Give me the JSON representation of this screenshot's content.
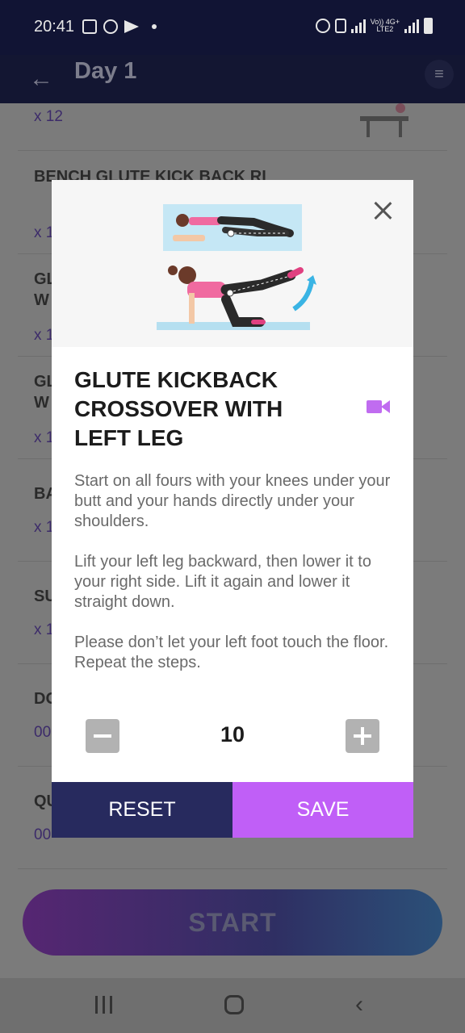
{
  "status_bar": {
    "time": "20:41",
    "network_label_top": "Vo)) 4G+",
    "network_label_bottom": "LTE2"
  },
  "app_bar": {
    "title": "Day 1"
  },
  "background_list": [
    {
      "name": "",
      "count": "x 12"
    },
    {
      "name": "BENCH GLUTE KICK BACK RI",
      "count": "x 1"
    },
    {
      "name": "GL W",
      "count": "x 1"
    },
    {
      "name": "GL W",
      "count": "x 1"
    },
    {
      "name": "BA",
      "count": "x 1"
    },
    {
      "name": "SU",
      "count": "x 1"
    },
    {
      "name": "DO",
      "count": "00"
    },
    {
      "name": "QU",
      "count": "00"
    }
  ],
  "start_button": {
    "label": "START"
  },
  "dialog": {
    "title": "GLUTE KICKBACK CROSSOVER WITH LEFT LEG",
    "description": [
      "Start on all fours with your knees under your butt and your hands directly under your shoulders.",
      "Lift your left leg backward, then lower it to your right side. Lift it again and lower it straight down.",
      "Please don’t let your left foot touch the floor. Repeat the steps."
    ],
    "reps_value": "10",
    "reset_label": "RESET",
    "save_label": "SAVE"
  },
  "colors": {
    "accent_purple": "#c05ff7",
    "navy": "#272a5e",
    "icon_purple": "#c06cf0"
  },
  "icons": {
    "back": "arrow-left-icon",
    "edit_list": "edit-list-icon",
    "close": "close-icon",
    "video": "video-camera-icon",
    "minus": "minus-icon",
    "plus": "plus-icon"
  }
}
